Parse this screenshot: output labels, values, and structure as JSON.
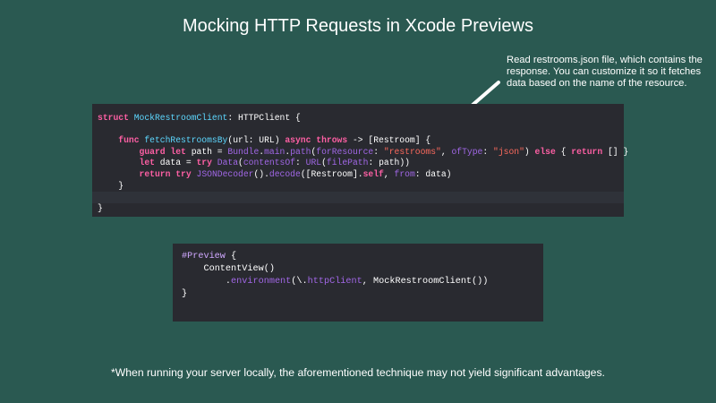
{
  "slide": {
    "title": "Mocking HTTP Requests in Xcode Previews",
    "callout": "Read restrooms.json file, which contains the response. You can customize it so it fetches data based on the name of the resource.",
    "footnote": "*When running your server locally, the aforementioned technique may not yield significant advantages."
  },
  "code_main": [
    {
      "tokens": [
        {
          "t": "struct",
          "c": "kw"
        },
        {
          "t": " ",
          "c": "plain"
        },
        {
          "t": "MockRestroomClient",
          "c": "type"
        },
        {
          "t": ": ",
          "c": "plain"
        },
        {
          "t": "HTTPClient",
          "c": "plain"
        },
        {
          "t": " {",
          "c": "plain"
        }
      ]
    },
    {
      "tokens": []
    },
    {
      "tokens": [
        {
          "t": "    ",
          "c": "plain"
        },
        {
          "t": "func",
          "c": "kw"
        },
        {
          "t": " ",
          "c": "plain"
        },
        {
          "t": "fetchRestroomsBy",
          "c": "type"
        },
        {
          "t": "(url: ",
          "c": "plain"
        },
        {
          "t": "URL",
          "c": "plain"
        },
        {
          "t": ") ",
          "c": "plain"
        },
        {
          "t": "async",
          "c": "kw"
        },
        {
          "t": " ",
          "c": "plain"
        },
        {
          "t": "throws",
          "c": "kw"
        },
        {
          "t": " -> [",
          "c": "plain"
        },
        {
          "t": "Restroom",
          "c": "plain"
        },
        {
          "t": "] {",
          "c": "plain"
        }
      ]
    },
    {
      "tokens": [
        {
          "t": "        ",
          "c": "plain"
        },
        {
          "t": "guard",
          "c": "kw"
        },
        {
          "t": " ",
          "c": "plain"
        },
        {
          "t": "let",
          "c": "kw"
        },
        {
          "t": " path = ",
          "c": "plain"
        },
        {
          "t": "Bundle",
          "c": "proj"
        },
        {
          "t": ".",
          "c": "plain"
        },
        {
          "t": "main",
          "c": "proj"
        },
        {
          "t": ".",
          "c": "plain"
        },
        {
          "t": "path",
          "c": "proj"
        },
        {
          "t": "(",
          "c": "plain"
        },
        {
          "t": "forResource",
          "c": "proj"
        },
        {
          "t": ": ",
          "c": "plain"
        },
        {
          "t": "\"restrooms\"",
          "c": "str"
        },
        {
          "t": ", ",
          "c": "plain"
        },
        {
          "t": "ofType",
          "c": "proj"
        },
        {
          "t": ": ",
          "c": "plain"
        },
        {
          "t": "\"json\"",
          "c": "str"
        },
        {
          "t": ") ",
          "c": "plain"
        },
        {
          "t": "else",
          "c": "kw"
        },
        {
          "t": " { ",
          "c": "plain"
        },
        {
          "t": "return",
          "c": "kw"
        },
        {
          "t": " [] }",
          "c": "plain"
        }
      ]
    },
    {
      "tokens": [
        {
          "t": "        ",
          "c": "plain"
        },
        {
          "t": "let",
          "c": "kw"
        },
        {
          "t": " data = ",
          "c": "plain"
        },
        {
          "t": "try",
          "c": "kw"
        },
        {
          "t": " ",
          "c": "plain"
        },
        {
          "t": "Data",
          "c": "proj"
        },
        {
          "t": "(",
          "c": "plain"
        },
        {
          "t": "contentsOf",
          "c": "proj"
        },
        {
          "t": ": ",
          "c": "plain"
        },
        {
          "t": "URL",
          "c": "proj"
        },
        {
          "t": "(",
          "c": "plain"
        },
        {
          "t": "filePath",
          "c": "proj"
        },
        {
          "t": ": path))",
          "c": "plain"
        }
      ]
    },
    {
      "tokens": [
        {
          "t": "        ",
          "c": "plain"
        },
        {
          "t": "return",
          "c": "kw"
        },
        {
          "t": " ",
          "c": "plain"
        },
        {
          "t": "try",
          "c": "kw"
        },
        {
          "t": " ",
          "c": "plain"
        },
        {
          "t": "JSONDecoder",
          "c": "proj"
        },
        {
          "t": "().",
          "c": "plain"
        },
        {
          "t": "decode",
          "c": "proj"
        },
        {
          "t": "([",
          "c": "plain"
        },
        {
          "t": "Restroom",
          "c": "plain"
        },
        {
          "t": "].",
          "c": "plain"
        },
        {
          "t": "self",
          "c": "kw"
        },
        {
          "t": ", ",
          "c": "plain"
        },
        {
          "t": "from",
          "c": "proj"
        },
        {
          "t": ": data)",
          "c": "plain"
        }
      ]
    },
    {
      "tokens": [
        {
          "t": "    }",
          "c": "plain"
        }
      ]
    },
    {
      "tokens": [],
      "highlight": true
    },
    {
      "tokens": [
        {
          "t": "}",
          "c": "plain"
        }
      ]
    }
  ],
  "code_preview": [
    {
      "tokens": [
        {
          "t": "#Preview",
          "c": "attr"
        },
        {
          "t": " {",
          "c": "plain"
        }
      ]
    },
    {
      "tokens": [
        {
          "t": "    ",
          "c": "plain"
        },
        {
          "t": "ContentView",
          "c": "plain"
        },
        {
          "t": "()",
          "c": "plain"
        }
      ]
    },
    {
      "tokens": [
        {
          "t": "        .",
          "c": "plain"
        },
        {
          "t": "environment",
          "c": "proj"
        },
        {
          "t": "(\\.",
          "c": "plain"
        },
        {
          "t": "httpClient",
          "c": "proj"
        },
        {
          "t": ", ",
          "c": "plain"
        },
        {
          "t": "MockRestroomClient",
          "c": "plain"
        },
        {
          "t": "())",
          "c": "plain"
        }
      ]
    },
    {
      "tokens": [
        {
          "t": "}",
          "c": "plain"
        }
      ]
    }
  ],
  "colors": {
    "background": "#2a5951",
    "code_background": "#292a30",
    "keyword": "#fc5fa3",
    "type_declaration": "#5dd8ff",
    "project_symbol": "#a167e6",
    "string": "#fc6a5d",
    "attribute": "#d0a8ff"
  }
}
